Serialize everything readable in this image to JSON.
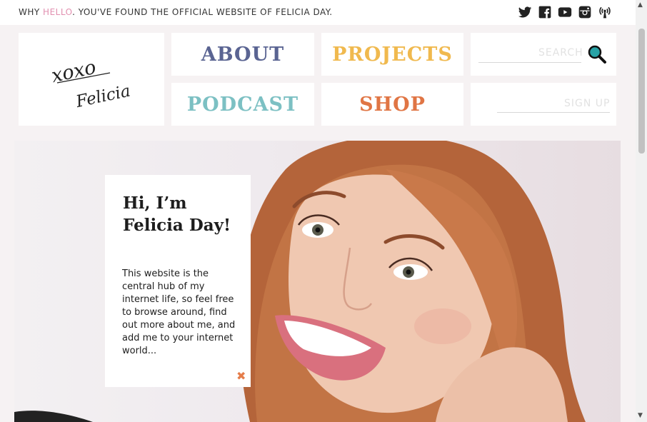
{
  "topbar": {
    "tagline_pre": "WHY ",
    "tagline_highlight": "HELLO",
    "tagline_post": ". YOU'VE FOUND THE OFFICIAL WEBSITE OF FELICIA DAY.",
    "highlight_color": "#e290b0",
    "social_icons": [
      "twitter-icon",
      "facebook-icon",
      "youtube-icon",
      "instagram-icon",
      "podcast-icon"
    ]
  },
  "logo": {
    "line1": "xoxo",
    "line2": "Felicia"
  },
  "nav": {
    "about": "ABOUT",
    "projects": "PROJECTS",
    "podcast": "PODCAST",
    "shop": "SHOP",
    "colors": {
      "about": "#5a6492",
      "projects": "#f0b94e",
      "podcast": "#7cc0c3",
      "shop": "#e07544"
    }
  },
  "search": {
    "placeholder": "SEARCH",
    "icon": "search-icon",
    "icon_color": "#28a3a6"
  },
  "signup": {
    "placeholder": "SIGN UP"
  },
  "intro": {
    "title": "Hi, I’m Felicia Day!",
    "body": "This website is the central hub of my internet life, so feel free to browse around, find out more about me, and add me to your internet world...",
    "close_icon": "close-icon"
  },
  "hero": {
    "image": "portrait of Felicia Day"
  }
}
